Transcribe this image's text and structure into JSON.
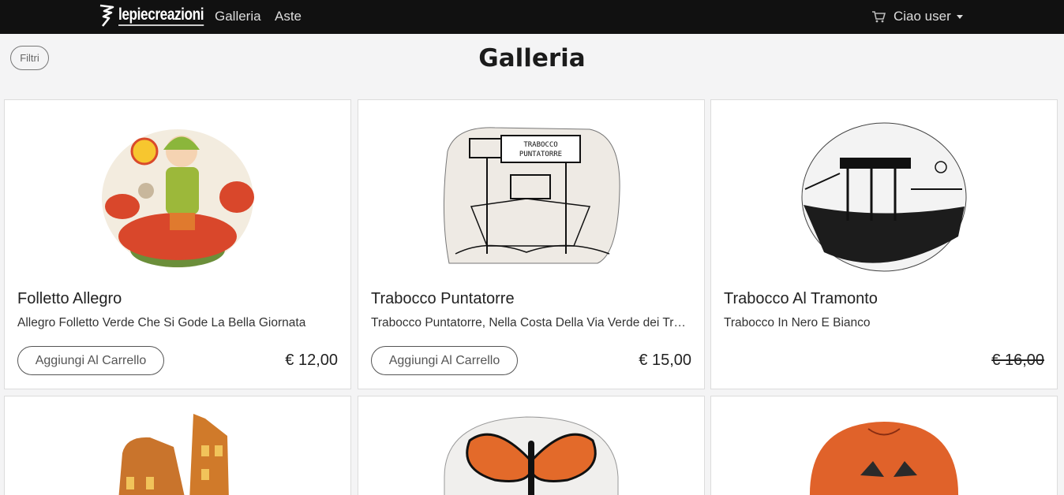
{
  "nav": {
    "brand": "lepiecreazioni",
    "links": [
      "Galleria",
      "Aste"
    ],
    "user_label": "Ciao user"
  },
  "filters_label": "Filtri",
  "page_title": "Galleria",
  "products": [
    {
      "title": "Folletto Allegro",
      "description": "Allegro Folletto Verde Che Si Gode La Bella Giornata",
      "button": "Aggiungi Al Carrello",
      "price": "€ 12,00"
    },
    {
      "title": "Trabocco Puntatorre",
      "description": "Trabocco Puntatorre, Nella Costa Della Via Verde dei Trabocchi",
      "button": "Aggiungi Al Carrello",
      "price": "€ 15,00"
    },
    {
      "title": "Trabocco Al Tramonto",
      "description": "Trabocco In Nero E Bianco",
      "button": "",
      "price": "€ 16,00"
    }
  ],
  "image_labels": {
    "trabocco_sign": "TRABOCCO PUNTATORRE"
  },
  "colors": {
    "navbar": "#111111",
    "background": "#f4f4f5",
    "accent_red": "#d9472b"
  }
}
